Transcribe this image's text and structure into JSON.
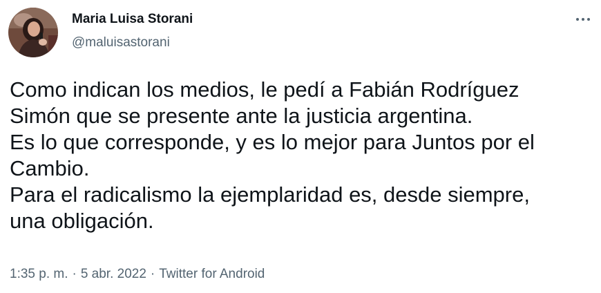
{
  "author": {
    "display_name": "Maria Luisa Storani",
    "handle": "@maluisastorani",
    "avatar_icon": "profile-photo"
  },
  "more_icon": "more-horizontal-icon",
  "tweet": {
    "lines": [
      "Como indican los medios, le pedí a Fabián Rodríguez",
      "Simón que se presente ante la justicia argentina.",
      "Es lo que corresponde, y es lo mejor para Juntos por el",
      "Cambio.",
      "Para el radicalismo la ejemplaridad es, desde siempre,",
      "una obligación."
    ]
  },
  "meta": {
    "time": "1:35 p. m.",
    "separator": "·",
    "date": "5 abr. 2022",
    "source": "Twitter for Android"
  },
  "colors": {
    "text_primary": "#0f1419",
    "text_secondary": "#536471",
    "background": "#ffffff"
  }
}
